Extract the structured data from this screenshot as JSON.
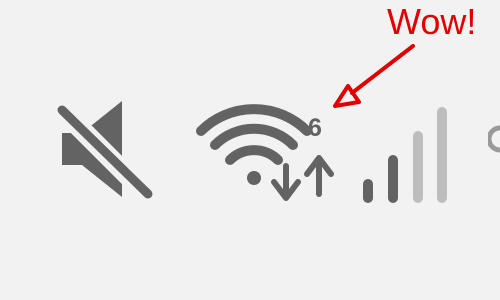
{
  "annotation": {
    "text": "Wow!",
    "color": "#e00000"
  },
  "statusbar": {
    "icon_color": "#636363",
    "dim_color": "#bdbdbd",
    "mute": {
      "icon": "volume-muted-icon"
    },
    "wifi": {
      "icon": "wifi-icon",
      "badge": "6",
      "download_icon": "arrow-down-icon",
      "upload_icon": "arrow-up-icon"
    },
    "signal": {
      "icon": "cellular-signal-icon",
      "bars_total": 4,
      "bars_active": 2
    }
  }
}
